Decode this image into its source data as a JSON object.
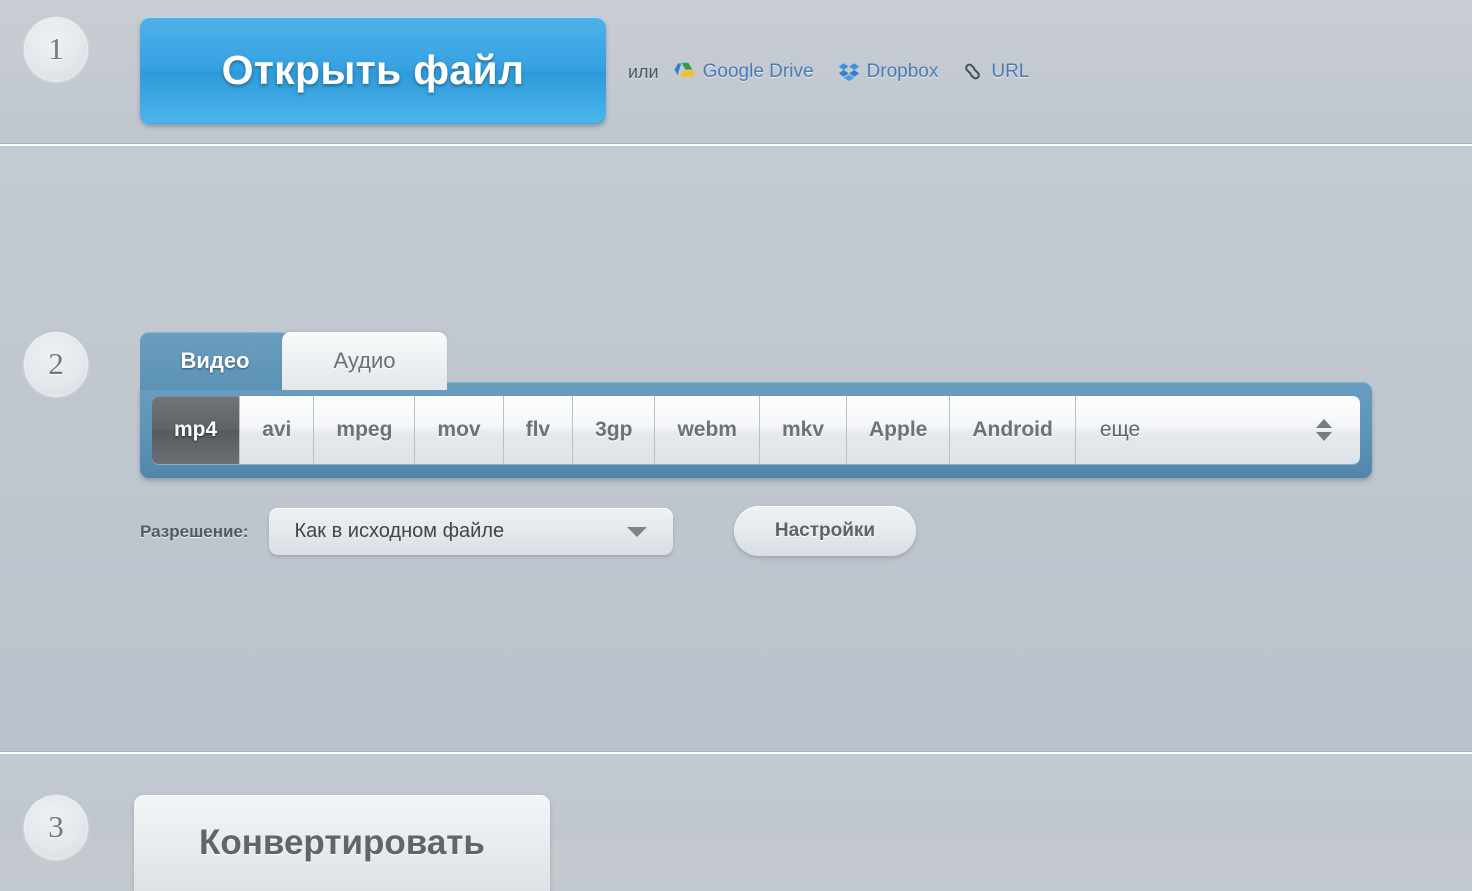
{
  "step1": {
    "number": "1",
    "open_file_label": "Открыть файл",
    "or_label": "или",
    "cloud_links": [
      {
        "label": "Google Drive",
        "icon": "google-drive-icon"
      },
      {
        "label": "Dropbox",
        "icon": "dropbox-icon"
      },
      {
        "label": "URL",
        "icon": "link-icon"
      }
    ]
  },
  "step2": {
    "number": "2",
    "tabs": [
      {
        "label": "Видео",
        "active": true
      },
      {
        "label": "Аудио",
        "active": false
      }
    ],
    "formats": [
      {
        "label": "mp4",
        "selected": true
      },
      {
        "label": "avi",
        "selected": false
      },
      {
        "label": "mpeg",
        "selected": false
      },
      {
        "label": "mov",
        "selected": false
      },
      {
        "label": "flv",
        "selected": false
      },
      {
        "label": "3gp",
        "selected": false
      },
      {
        "label": "webm",
        "selected": false
      },
      {
        "label": "mkv",
        "selected": false
      },
      {
        "label": "Apple",
        "selected": false
      },
      {
        "label": "Android",
        "selected": false
      }
    ],
    "more_label": "еще",
    "resolution_label": "Разрешение:",
    "resolution_value": "Как в исходном файле",
    "settings_label": "Настройки"
  },
  "step3": {
    "number": "3",
    "convert_label": "Конвертировать"
  },
  "colors": {
    "accent_blue": "#36a2e2",
    "panel_blue": "#5d93b7",
    "link_blue": "#4a7cb5",
    "selected_gray": "#5e6368",
    "page_bg": "#c2c8cf"
  }
}
